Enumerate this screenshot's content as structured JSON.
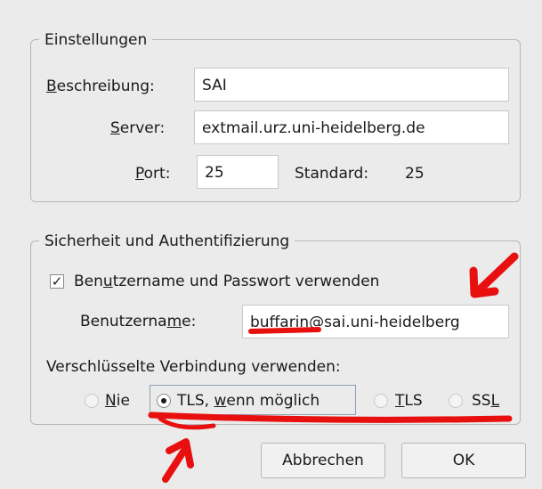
{
  "settings": {
    "legend": "Einstellungen",
    "description": {
      "label": "Beschreibung:",
      "value": "SAI"
    },
    "server": {
      "label": "Server:",
      "value": "extmail.urz.uni-heidelberg.de"
    },
    "port": {
      "label": "Port:",
      "value": "25",
      "default_label": "Standard:",
      "default_value": "25"
    }
  },
  "security": {
    "legend": "Sicherheit und Authentifizierung",
    "use_credentials": {
      "label": "Benutzername und Passwort verwenden",
      "checked": true
    },
    "username": {
      "label": "Benutzername:",
      "value": "buffarin@sai.uni-heidelberg"
    },
    "encryption": {
      "label": "Verschlüsselte Verbindung verwenden:",
      "selected": "TLS, wenn möglich",
      "options": [
        "Nie",
        "TLS, wenn möglich",
        "TLS",
        "SSL"
      ]
    }
  },
  "buttons": {
    "cancel": "Abbrechen",
    "ok": "OK"
  },
  "colors": {
    "annotation": "#e8100f"
  }
}
